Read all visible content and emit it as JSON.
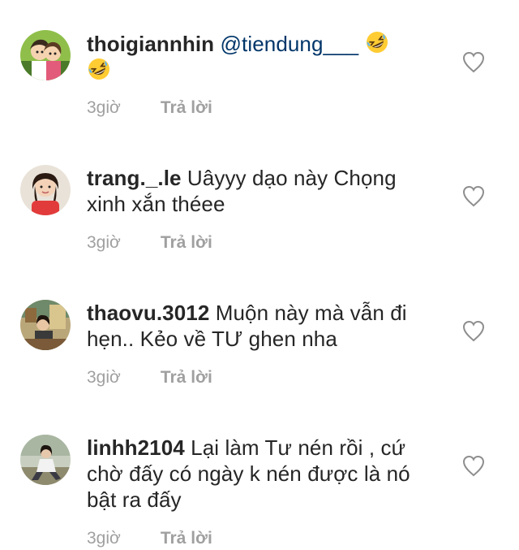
{
  "comments": [
    {
      "username": "thoigiannhin",
      "mention": "@tiendung___",
      "text": "",
      "emoji": "rolling-on-floor-laughing",
      "time": "3giờ",
      "reply_label": "Trả lời"
    },
    {
      "username": "trang._.le",
      "text": "Uâyyy dạo này Chọng xinh xắn théee",
      "time": "3giờ",
      "reply_label": "Trả lời"
    },
    {
      "username": "thaovu.3012",
      "text": "Muộn này mà vẫn đi hẹn.. Kẻo về TƯ ghen nha",
      "time": "3giờ",
      "reply_label": "Trả lời"
    },
    {
      "username": "linhh2104",
      "text": "Lại làm Tư nén rồi , cứ chờ đấy có ngày k nén được là nó bật ra đấy",
      "time": "3giờ",
      "reply_label": "Trả lời"
    }
  ],
  "colors": {
    "username": "#262626",
    "mention": "#003569",
    "meta": "#a0a0a0",
    "heart_outline": "#8e8e8e"
  },
  "icons": {
    "like": "heart-outline-icon",
    "emoji": "rolling-on-floor-laughing-emoji"
  }
}
